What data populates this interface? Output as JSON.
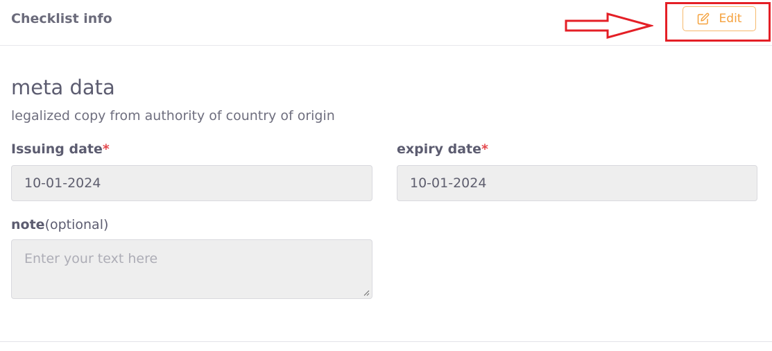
{
  "header": {
    "title": "Checklist info",
    "edit_button": {
      "label": "Edit",
      "icon": "edit-icon",
      "color": "#f5a13d"
    }
  },
  "annotation": {
    "color": "#e41f26",
    "arrow_icon": "arrow-right-icon"
  },
  "section": {
    "title": "meta data",
    "subtitle": "legalized copy from authority of country of origin"
  },
  "fields": {
    "issuing_date": {
      "label": "Issuing date",
      "required_mark": "*",
      "value": "10-01-2024"
    },
    "expiry_date": {
      "label": "expiry date",
      "required_mark": "*",
      "value": "10-01-2024"
    },
    "note": {
      "label": "note",
      "optional_text": "(optional)",
      "placeholder": "Enter your text here"
    }
  }
}
